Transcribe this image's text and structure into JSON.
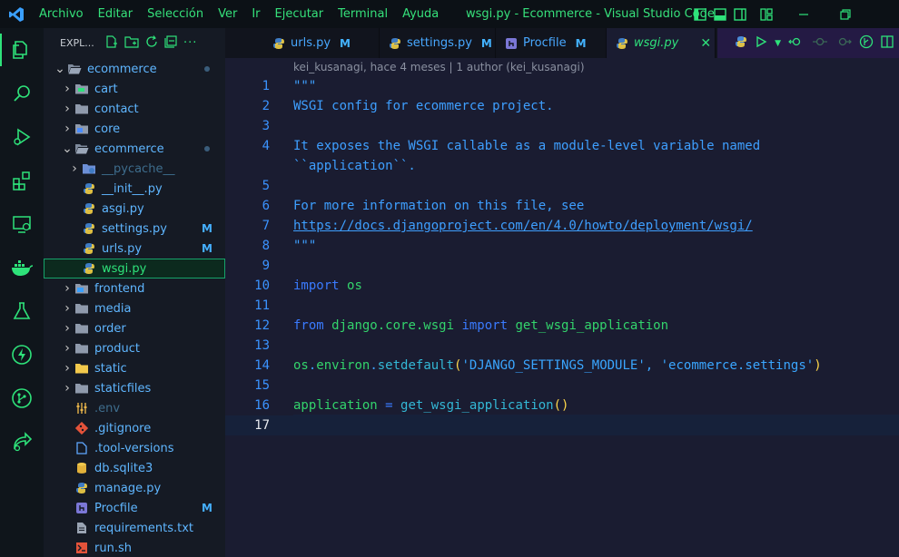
{
  "titlebar": {
    "menu": [
      "Archivo",
      "Editar",
      "Selección",
      "Ver",
      "Ir",
      "Ejecutar",
      "Terminal",
      "Ayuda"
    ],
    "window_title": "wsgi.py - Ecommerce - Visual Studio Code"
  },
  "activity_bar": {
    "items": [
      "explorer-icon",
      "search-icon",
      "run-debug-icon",
      "extensions-icon",
      "remote-explorer-icon",
      "docker-icon",
      "testing-icon",
      "thunder-client-icon",
      "git-graph-icon",
      "live-share-icon"
    ]
  },
  "sidebar": {
    "header": "EXPL...",
    "tree": [
      {
        "label": "ecommerce",
        "type": "folder-open",
        "indent": 0,
        "dot": true
      },
      {
        "label": "cart",
        "type": "folder",
        "indent": 1
      },
      {
        "label": "contact",
        "type": "folder",
        "indent": 1
      },
      {
        "label": "core",
        "type": "folder",
        "indent": 1
      },
      {
        "label": "ecommerce",
        "type": "folder-open",
        "indent": 1,
        "dot": true
      },
      {
        "label": "__pycache__",
        "type": "folder",
        "indent": 2,
        "dim": true
      },
      {
        "label": "__init__.py",
        "type": "py",
        "indent": 2
      },
      {
        "label": "asgi.py",
        "type": "py",
        "indent": 2
      },
      {
        "label": "settings.py",
        "type": "py",
        "indent": 2,
        "badge": "M"
      },
      {
        "label": "urls.py",
        "type": "py",
        "indent": 2,
        "badge": "M"
      },
      {
        "label": "wsgi.py",
        "type": "py",
        "indent": 2,
        "selected": true
      },
      {
        "label": "frontend",
        "type": "folder",
        "indent": 1
      },
      {
        "label": "media",
        "type": "folder",
        "indent": 1
      },
      {
        "label": "order",
        "type": "folder",
        "indent": 1
      },
      {
        "label": "product",
        "type": "folder",
        "indent": 1
      },
      {
        "label": "static",
        "type": "folder",
        "indent": 1
      },
      {
        "label": "staticfiles",
        "type": "folder",
        "indent": 1
      },
      {
        "label": ".env",
        "type": "env",
        "indent": 1,
        "dim": true
      },
      {
        "label": ".gitignore",
        "type": "git",
        "indent": 1
      },
      {
        "label": ".tool-versions",
        "type": "file",
        "indent": 1
      },
      {
        "label": "db.sqlite3",
        "type": "db",
        "indent": 1
      },
      {
        "label": "manage.py",
        "type": "py",
        "indent": 1
      },
      {
        "label": "Procfile",
        "type": "heroku",
        "indent": 1,
        "badge": "M"
      },
      {
        "label": "requirements.txt",
        "type": "txt",
        "indent": 1
      },
      {
        "label": "run.sh",
        "type": "sh",
        "indent": 1
      }
    ]
  },
  "tabs": [
    {
      "label": "urls.py",
      "modified": "M",
      "icon": "python-icon"
    },
    {
      "label": "settings.py",
      "modified": "M",
      "icon": "python-icon"
    },
    {
      "label": "Procfile",
      "modified": "M",
      "icon": "heroku-icon"
    },
    {
      "label": "wsgi.py",
      "active": true,
      "close": "✕",
      "icon": "python-icon"
    }
  ],
  "editor": {
    "blame": "kei_kusanagi, hace 4 meses | 1 author (kei_kusanagi)",
    "lines": [
      {
        "n": "1",
        "t": "\"\"\""
      },
      {
        "n": "2",
        "t": "WSGI config for ecommerce project."
      },
      {
        "n": "3",
        "t": ""
      },
      {
        "n": "4",
        "t": "It exposes the WSGI callable as a module-level variable named"
      },
      {
        "n": "",
        "t": "``application``."
      },
      {
        "n": "5",
        "t": ""
      },
      {
        "n": "6",
        "t": "For more information on this file, see"
      },
      {
        "n": "7",
        "t": "https://docs.djangoproject.com/en/4.0/howto/deployment/wsgi/"
      },
      {
        "n": "8",
        "t": "\"\"\""
      },
      {
        "n": "9",
        "t": ""
      },
      {
        "n": "10",
        "t": "import os"
      },
      {
        "n": "11",
        "t": ""
      },
      {
        "n": "12",
        "t": "from django.core.wsgi import get_wsgi_application"
      },
      {
        "n": "13",
        "t": ""
      },
      {
        "n": "14",
        "t": "os.environ.setdefault('DJANGO_SETTINGS_MODULE', 'ecommerce.settings')"
      },
      {
        "n": "15",
        "t": ""
      },
      {
        "n": "16",
        "t": "application = get_wsgi_application()"
      },
      {
        "n": "17",
        "t": ""
      }
    ]
  }
}
